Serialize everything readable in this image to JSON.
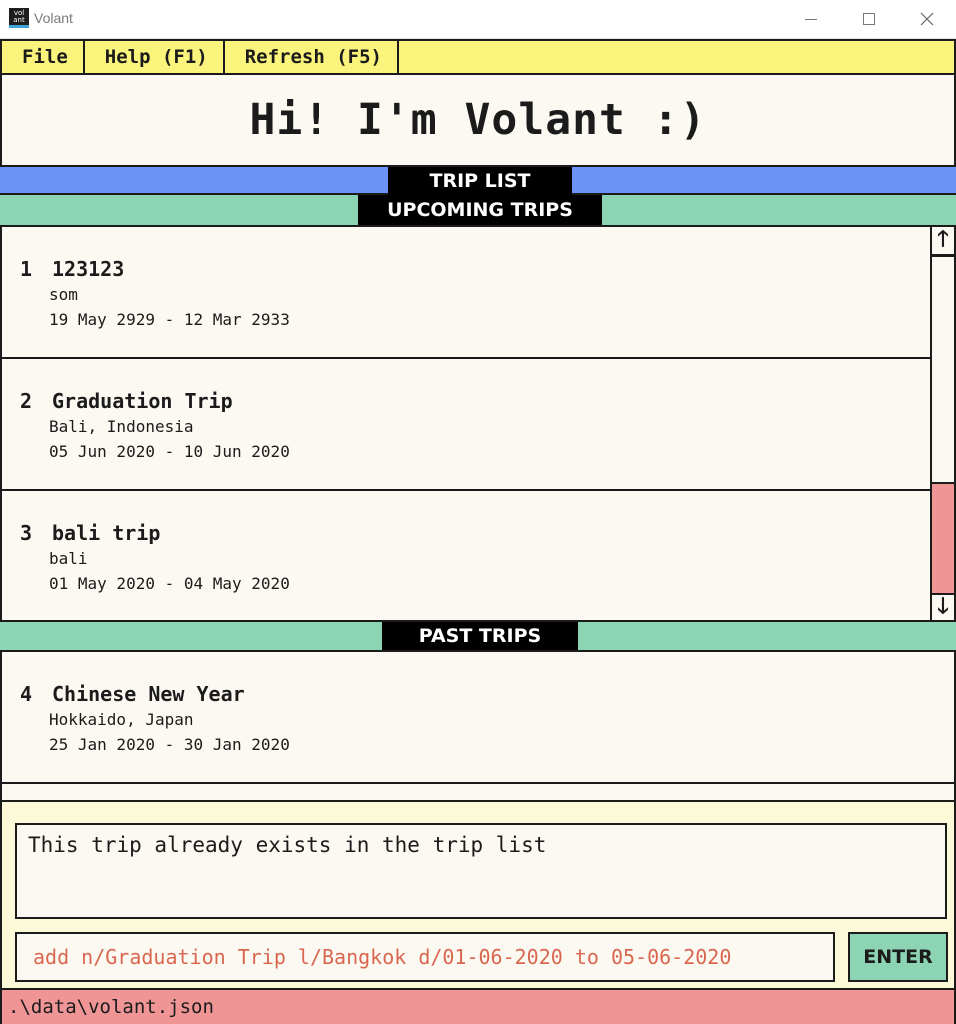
{
  "window": {
    "title": "Volant",
    "icon_text_top": "vol",
    "icon_text_bottom": "ant"
  },
  "menu": {
    "file": "File",
    "help": "Help (F1)",
    "refresh": "Refresh (F5)"
  },
  "greeting": "Hi! I'm Volant :)",
  "sections": {
    "trip_list": "TRIP LIST",
    "upcoming": "UPCOMING TRIPS",
    "past": "PAST TRIPS"
  },
  "upcoming_trips": [
    {
      "index": "1",
      "name": "123123",
      "destination": "som",
      "dates": "19 May 2929 - 12 Mar 2933"
    },
    {
      "index": "2",
      "name": "Graduation Trip",
      "destination": "Bali, Indonesia",
      "dates": "05 Jun 2020 - 10 Jun 2020"
    },
    {
      "index": "3",
      "name": "bali trip",
      "destination": "bali",
      "dates": "01 May 2020 - 04 May 2020"
    }
  ],
  "past_trips": [
    {
      "index": "4",
      "name": "Chinese New Year",
      "destination": "Hokkaido, Japan",
      "dates": "25 Jan 2020 - 30 Jan 2020"
    }
  ],
  "result_message": "This trip already exists in the trip list",
  "command_input": {
    "value": "add n/Graduation Trip l/Bangkok d/01-06-2020 to 05-06-2020",
    "placeholder": ""
  },
  "enter_label": "ENTER",
  "status_path": ".\\data\\volant.json",
  "scrollbar": {
    "up_arrow": "🡑",
    "down_arrow": "🡓"
  },
  "colors": {
    "menu_bar": "#fbf47c",
    "trip_list_bar": "#6b92f7",
    "section_bar": "#8cd4b4",
    "status_bar": "#ef9595",
    "command_text": "#d9674f",
    "panel_background": "#fcf9f2"
  }
}
